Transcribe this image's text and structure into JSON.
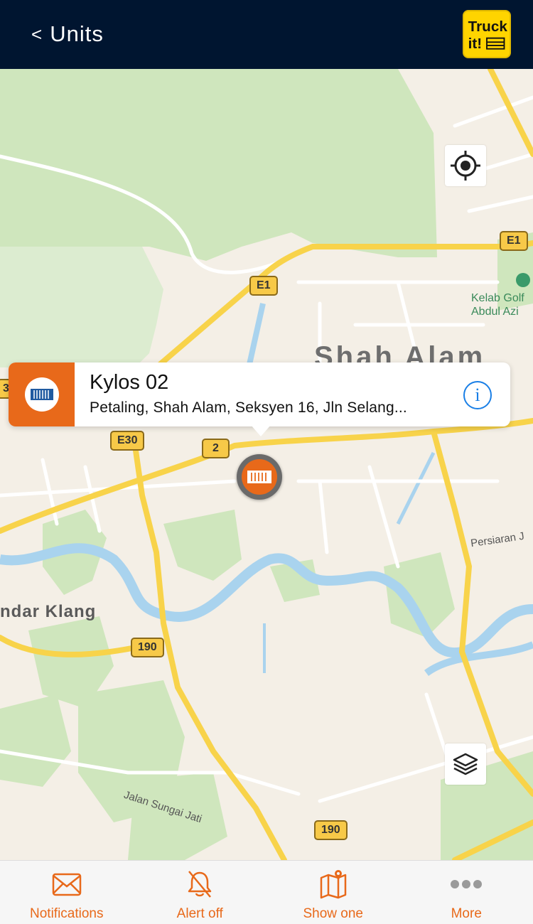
{
  "header": {
    "back_label": "Units",
    "logo_text": "Truck it!"
  },
  "map": {
    "city_label": "Shah Alam",
    "town_label": "ndar Klang",
    "street_labels": [
      "Jalan Sungai Jati",
      "Persiaran J"
    ],
    "poi_label_line1": "Kelab Golf",
    "poi_label_line2": "Abdul Azi",
    "road_shields": [
      "E1",
      "E1",
      "E30",
      "2",
      "190",
      "190",
      "3"
    ],
    "colors": {
      "land": "#f4efe6",
      "park": "#cfe6bd",
      "water": "#a9d3ee",
      "highway": "#f8d34a",
      "road": "#ffffff"
    }
  },
  "callout": {
    "title": "Kylos 02",
    "subtitle": "Petaling, Shah Alam, Seksyen 16, Jln Selang...",
    "accent": "#e8691a",
    "info_icon": "info-icon"
  },
  "tabs": [
    {
      "label": "Notifications",
      "icon": "envelope-icon"
    },
    {
      "label": "Alert off",
      "icon": "bell-off-icon"
    },
    {
      "label": "Show one",
      "icon": "map-pin-icon"
    },
    {
      "label": "More",
      "icon": "more-icon"
    }
  ],
  "theme": {
    "header_bg": "#001530",
    "accent": "#e8691a",
    "logo_bg": "#ffd400"
  }
}
